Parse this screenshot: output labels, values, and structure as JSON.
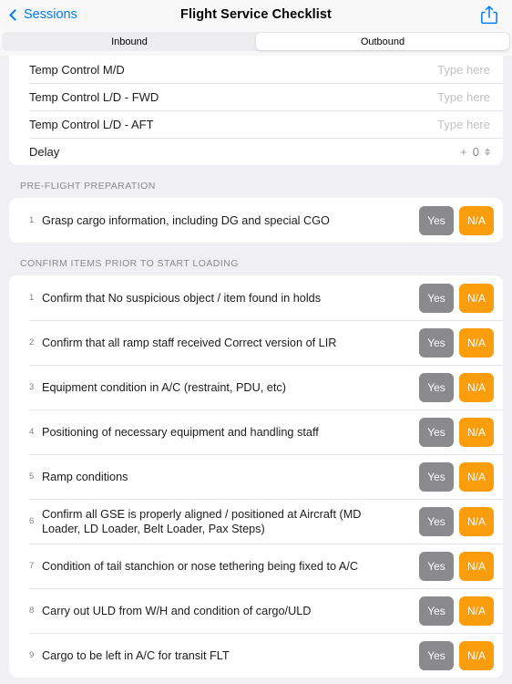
{
  "navbar": {
    "back_label": "Sessions",
    "title": "Flight Service Checklist",
    "share_icon": "share-icon"
  },
  "segmented": {
    "options": [
      {
        "label": "Inbound",
        "selected": false
      },
      {
        "label": "Outbound",
        "selected": true
      }
    ]
  },
  "info_card": {
    "rows": [
      {
        "label": "Temp Control M/D",
        "placeholder": "Type here",
        "value": ""
      },
      {
        "label": "Temp Control L/D - FWD",
        "placeholder": "Type here",
        "value": ""
      },
      {
        "label": "Temp Control L/D - AFT",
        "placeholder": "Type here",
        "value": ""
      }
    ],
    "delay": {
      "label": "Delay",
      "sign": "+",
      "value": "0"
    }
  },
  "sections": [
    {
      "header": "PRE-FLIGHT PREPARATION",
      "items": [
        {
          "index": "1",
          "text": "Grasp cargo information, including DG and special CGO",
          "yes_label": "Yes",
          "na_label": "N/A"
        }
      ]
    },
    {
      "header": "CONFIRM ITEMS PRIOR TO START LOADING",
      "items": [
        {
          "index": "1",
          "text": "Confirm that No suspicious object / item found in holds",
          "yes_label": "Yes",
          "na_label": "N/A"
        },
        {
          "index": "2",
          "text": "Confirm that all ramp staff received Correct version of LIR",
          "yes_label": "Yes",
          "na_label": "N/A"
        },
        {
          "index": "3",
          "text": "Equipment condition in A/C (restraint, PDU, etc)",
          "yes_label": "Yes",
          "na_label": "N/A"
        },
        {
          "index": "4",
          "text": "Positioning of necessary equipment and handling staff",
          "yes_label": "Yes",
          "na_label": "N/A"
        },
        {
          "index": "5",
          "text": "Ramp conditions",
          "yes_label": "Yes",
          "na_label": "N/A"
        },
        {
          "index": "6",
          "text": "Confirm all GSE is properly aligned / positioned at Aircraft (MD Loader, LD Loader, Belt Loader, Pax Steps)",
          "yes_label": "Yes",
          "na_label": "N/A"
        },
        {
          "index": "7",
          "text": "Condition of tail stanchion or nose tethering being fixed to A/C",
          "yes_label": "Yes",
          "na_label": "N/A"
        },
        {
          "index": "8",
          "text": "Carry out ULD from W/H and condition of cargo/ULD",
          "yes_label": "Yes",
          "na_label": "N/A"
        },
        {
          "index": "9",
          "text": "Cargo to be left in A/C for transit FLT",
          "yes_label": "Yes",
          "na_label": "N/A"
        }
      ]
    }
  ],
  "colors": {
    "accent_blue": "#007AFF",
    "yes_gray": "#8A8A8E",
    "na_orange": "#FA9D0C",
    "page_background": "#EFEFF4"
  }
}
